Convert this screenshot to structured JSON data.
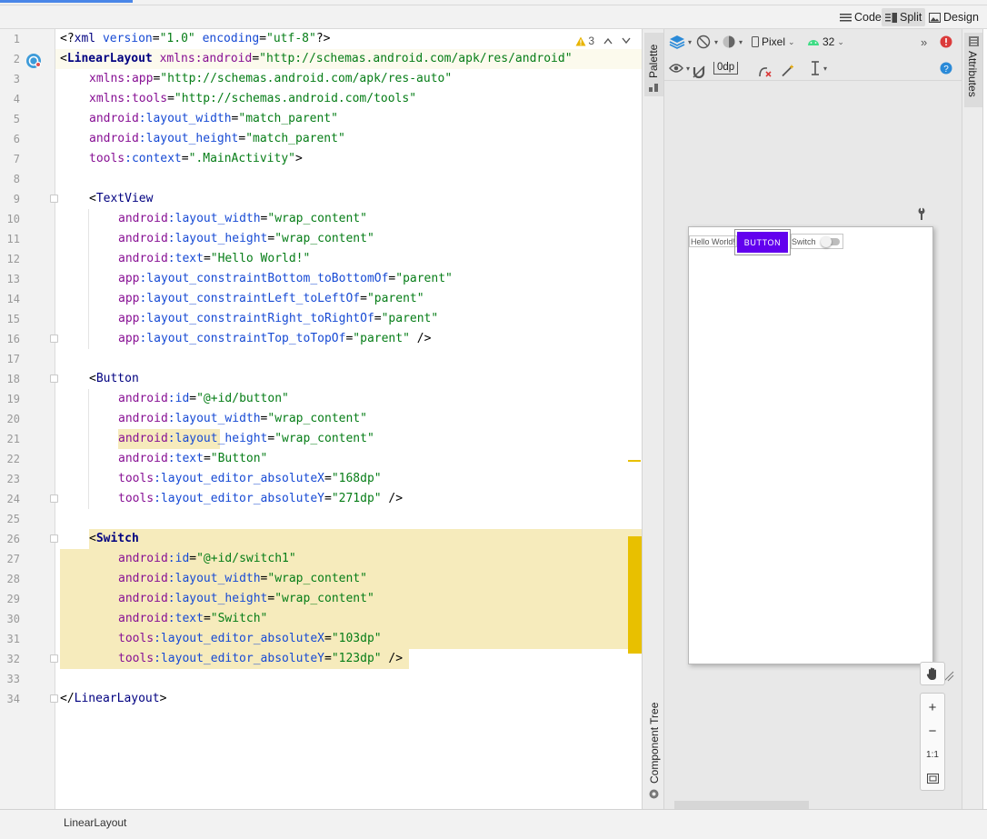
{
  "view_modes": [
    {
      "label": "Code",
      "icon": "lines-icon"
    },
    {
      "label": "Split",
      "icon": "split-icon",
      "active": true
    },
    {
      "label": "Design",
      "icon": "image-icon"
    }
  ],
  "editor": {
    "warning_count": "3",
    "lines": [
      {
        "n": "1",
        "indent": 0,
        "parts": [
          [
            "punct",
            "<?"
          ],
          [
            "tag",
            "xml "
          ],
          [
            "attr",
            "version"
          ],
          [
            "punct",
            "="
          ],
          [
            "val",
            "\"1.0\""
          ],
          [
            "punct",
            " "
          ],
          [
            "attr",
            "encoding"
          ],
          [
            "punct",
            "="
          ],
          [
            "val",
            "\"utf-8\""
          ],
          [
            "punct",
            "?>"
          ]
        ]
      },
      {
        "n": "2",
        "indent": 0,
        "parts": [
          [
            "punct",
            "<"
          ],
          [
            "tag",
            "LinearLayout"
          ],
          [
            "punct",
            " "
          ],
          [
            "ns",
            "xmlns:android"
          ],
          [
            "punct",
            "="
          ],
          [
            "val",
            "\"http://schemas.android.com/apk/res/android\""
          ]
        ]
      },
      {
        "n": "3",
        "indent": 1,
        "parts": [
          [
            "ns",
            "xmlns:app"
          ],
          [
            "punct",
            "="
          ],
          [
            "val",
            "\"http://schemas.android.com/apk/res-auto\""
          ]
        ]
      },
      {
        "n": "4",
        "indent": 1,
        "parts": [
          [
            "ns",
            "xmlns:tools"
          ],
          [
            "punct",
            "="
          ],
          [
            "val",
            "\"http://schemas.android.com/tools\""
          ]
        ]
      },
      {
        "n": "5",
        "indent": 1,
        "parts": [
          [
            "ns",
            "android"
          ],
          [
            "attr",
            ":layout_width"
          ],
          [
            "punct",
            "="
          ],
          [
            "val",
            "\"match_parent\""
          ]
        ]
      },
      {
        "n": "6",
        "indent": 1,
        "parts": [
          [
            "ns",
            "android"
          ],
          [
            "attr",
            ":layout_height"
          ],
          [
            "punct",
            "="
          ],
          [
            "val",
            "\"match_parent\""
          ]
        ]
      },
      {
        "n": "7",
        "indent": 1,
        "parts": [
          [
            "ns",
            "tools"
          ],
          [
            "attr",
            ":context"
          ],
          [
            "punct",
            "="
          ],
          [
            "val",
            "\".MainActivity\""
          ],
          [
            "punct",
            ">"
          ]
        ]
      },
      {
        "n": "8",
        "indent": 0,
        "parts": []
      },
      {
        "n": "9",
        "indent": 1,
        "parts": [
          [
            "punct",
            "<"
          ],
          [
            "tag",
            "TextView"
          ]
        ]
      },
      {
        "n": "10",
        "indent": 2,
        "parts": [
          [
            "ns",
            "android"
          ],
          [
            "attr",
            ":layout_width"
          ],
          [
            "punct",
            "="
          ],
          [
            "val",
            "\"wrap_content\""
          ]
        ]
      },
      {
        "n": "11",
        "indent": 2,
        "parts": [
          [
            "ns",
            "android"
          ],
          [
            "attr",
            ":layout_height"
          ],
          [
            "punct",
            "="
          ],
          [
            "val",
            "\"wrap_content\""
          ]
        ]
      },
      {
        "n": "12",
        "indent": 2,
        "parts": [
          [
            "ns",
            "android"
          ],
          [
            "attr",
            ":text"
          ],
          [
            "punct",
            "="
          ],
          [
            "val",
            "\"Hello World!\""
          ]
        ]
      },
      {
        "n": "13",
        "indent": 2,
        "parts": [
          [
            "ns",
            "app"
          ],
          [
            "attr",
            ":layout_constraintBottom_toBottomOf"
          ],
          [
            "punct",
            "="
          ],
          [
            "val",
            "\"parent\""
          ]
        ]
      },
      {
        "n": "14",
        "indent": 2,
        "parts": [
          [
            "ns",
            "app"
          ],
          [
            "attr",
            ":layout_constraintLeft_toLeftOf"
          ],
          [
            "punct",
            "="
          ],
          [
            "val",
            "\"parent\""
          ]
        ]
      },
      {
        "n": "15",
        "indent": 2,
        "parts": [
          [
            "ns",
            "app"
          ],
          [
            "attr",
            ":layout_constraintRight_toRightOf"
          ],
          [
            "punct",
            "="
          ],
          [
            "val",
            "\"parent\""
          ]
        ]
      },
      {
        "n": "16",
        "indent": 2,
        "parts": [
          [
            "ns",
            "app"
          ],
          [
            "attr",
            ":layout_constraintTop_toTopOf"
          ],
          [
            "punct",
            "="
          ],
          [
            "val",
            "\"parent\""
          ],
          [
            "punct",
            " />"
          ]
        ]
      },
      {
        "n": "17",
        "indent": 0,
        "parts": []
      },
      {
        "n": "18",
        "indent": 1,
        "parts": [
          [
            "punct",
            "<"
          ],
          [
            "tag",
            "Button"
          ]
        ]
      },
      {
        "n": "19",
        "indent": 2,
        "parts": [
          [
            "ns",
            "android"
          ],
          [
            "attr",
            ":id"
          ],
          [
            "punct",
            "="
          ],
          [
            "val",
            "\"@+id/button\""
          ]
        ]
      },
      {
        "n": "20",
        "indent": 2,
        "parts": [
          [
            "ns",
            "android"
          ],
          [
            "attr",
            ":layout_width"
          ],
          [
            "punct",
            "="
          ],
          [
            "val",
            "\"wrap_content\""
          ]
        ]
      },
      {
        "n": "21",
        "indent": 2,
        "parts": [
          [
            "ns",
            "android"
          ],
          [
            "attr",
            ":layout_height"
          ],
          [
            "punct",
            "="
          ],
          [
            "val",
            "\"wrap_content\""
          ]
        ]
      },
      {
        "n": "22",
        "indent": 2,
        "parts": [
          [
            "ns",
            "android"
          ],
          [
            "attr",
            ":text"
          ],
          [
            "punct",
            "="
          ],
          [
            "val",
            "\"Button\""
          ]
        ]
      },
      {
        "n": "23",
        "indent": 2,
        "parts": [
          [
            "ns",
            "tools"
          ],
          [
            "attr",
            ":layout_editor_absoluteX"
          ],
          [
            "punct",
            "="
          ],
          [
            "val",
            "\"168dp\""
          ]
        ]
      },
      {
        "n": "24",
        "indent": 2,
        "parts": [
          [
            "ns",
            "tools"
          ],
          [
            "attr",
            ":layout_editor_absoluteY"
          ],
          [
            "punct",
            "="
          ],
          [
            "val",
            "\"271dp\""
          ],
          [
            "punct",
            " />"
          ]
        ]
      },
      {
        "n": "25",
        "indent": 0,
        "parts": []
      },
      {
        "n": "26",
        "indent": 1,
        "parts": [
          [
            "punct",
            "<"
          ],
          [
            "tag",
            "Switch"
          ]
        ]
      },
      {
        "n": "27",
        "indent": 2,
        "parts": [
          [
            "ns",
            "android"
          ],
          [
            "attr",
            ":id"
          ],
          [
            "punct",
            "="
          ],
          [
            "val",
            "\"@+id/switch1\""
          ]
        ]
      },
      {
        "n": "28",
        "indent": 2,
        "parts": [
          [
            "ns",
            "android"
          ],
          [
            "attr",
            ":layout_width"
          ],
          [
            "punct",
            "="
          ],
          [
            "val",
            "\"wrap_content\""
          ]
        ]
      },
      {
        "n": "29",
        "indent": 2,
        "parts": [
          [
            "ns",
            "android"
          ],
          [
            "attr",
            ":layout_height"
          ],
          [
            "punct",
            "="
          ],
          [
            "val",
            "\"wrap_content\""
          ]
        ]
      },
      {
        "n": "30",
        "indent": 2,
        "parts": [
          [
            "ns",
            "android"
          ],
          [
            "attr",
            ":text"
          ],
          [
            "punct",
            "="
          ],
          [
            "val",
            "\"Switch\""
          ]
        ]
      },
      {
        "n": "31",
        "indent": 2,
        "parts": [
          [
            "ns",
            "tools"
          ],
          [
            "attr",
            ":layout_editor_absoluteX"
          ],
          [
            "punct",
            "="
          ],
          [
            "val",
            "\"103dp\""
          ]
        ]
      },
      {
        "n": "32",
        "indent": 2,
        "parts": [
          [
            "ns",
            "tools"
          ],
          [
            "attr",
            ":layout_editor_absoluteY"
          ],
          [
            "punct",
            "="
          ],
          [
            "val",
            "\"123dp\""
          ],
          [
            "punct",
            " />"
          ]
        ]
      },
      {
        "n": "33",
        "indent": 0,
        "parts": []
      },
      {
        "n": "34",
        "indent": 0,
        "parts": [
          [
            "punct",
            "</"
          ],
          [
            "tag",
            "LinearLayout"
          ],
          [
            "punct",
            ">"
          ]
        ]
      }
    ]
  },
  "side_tabs": {
    "palette": "Palette",
    "component_tree": "Component Tree",
    "attributes": "Attributes"
  },
  "design_toolbar": {
    "device": "Pixel",
    "api_level": "32",
    "margin": "0dp"
  },
  "preview": {
    "textview": "Hello World!",
    "button": "BUTTON",
    "switch": "Switch"
  },
  "zoom": {
    "plus": "+",
    "minus": "−",
    "one_to_one": "1:1"
  },
  "status_bar": {
    "breadcrumb": "LinearLayout"
  },
  "colors": {
    "accent_tab": "#4a86e8",
    "button_purple": "#6200ee",
    "highlight": "#f6ebbc",
    "change_marker": "#e8c000",
    "error_red": "#db3b3b",
    "help_blue": "#2a8ad8"
  }
}
